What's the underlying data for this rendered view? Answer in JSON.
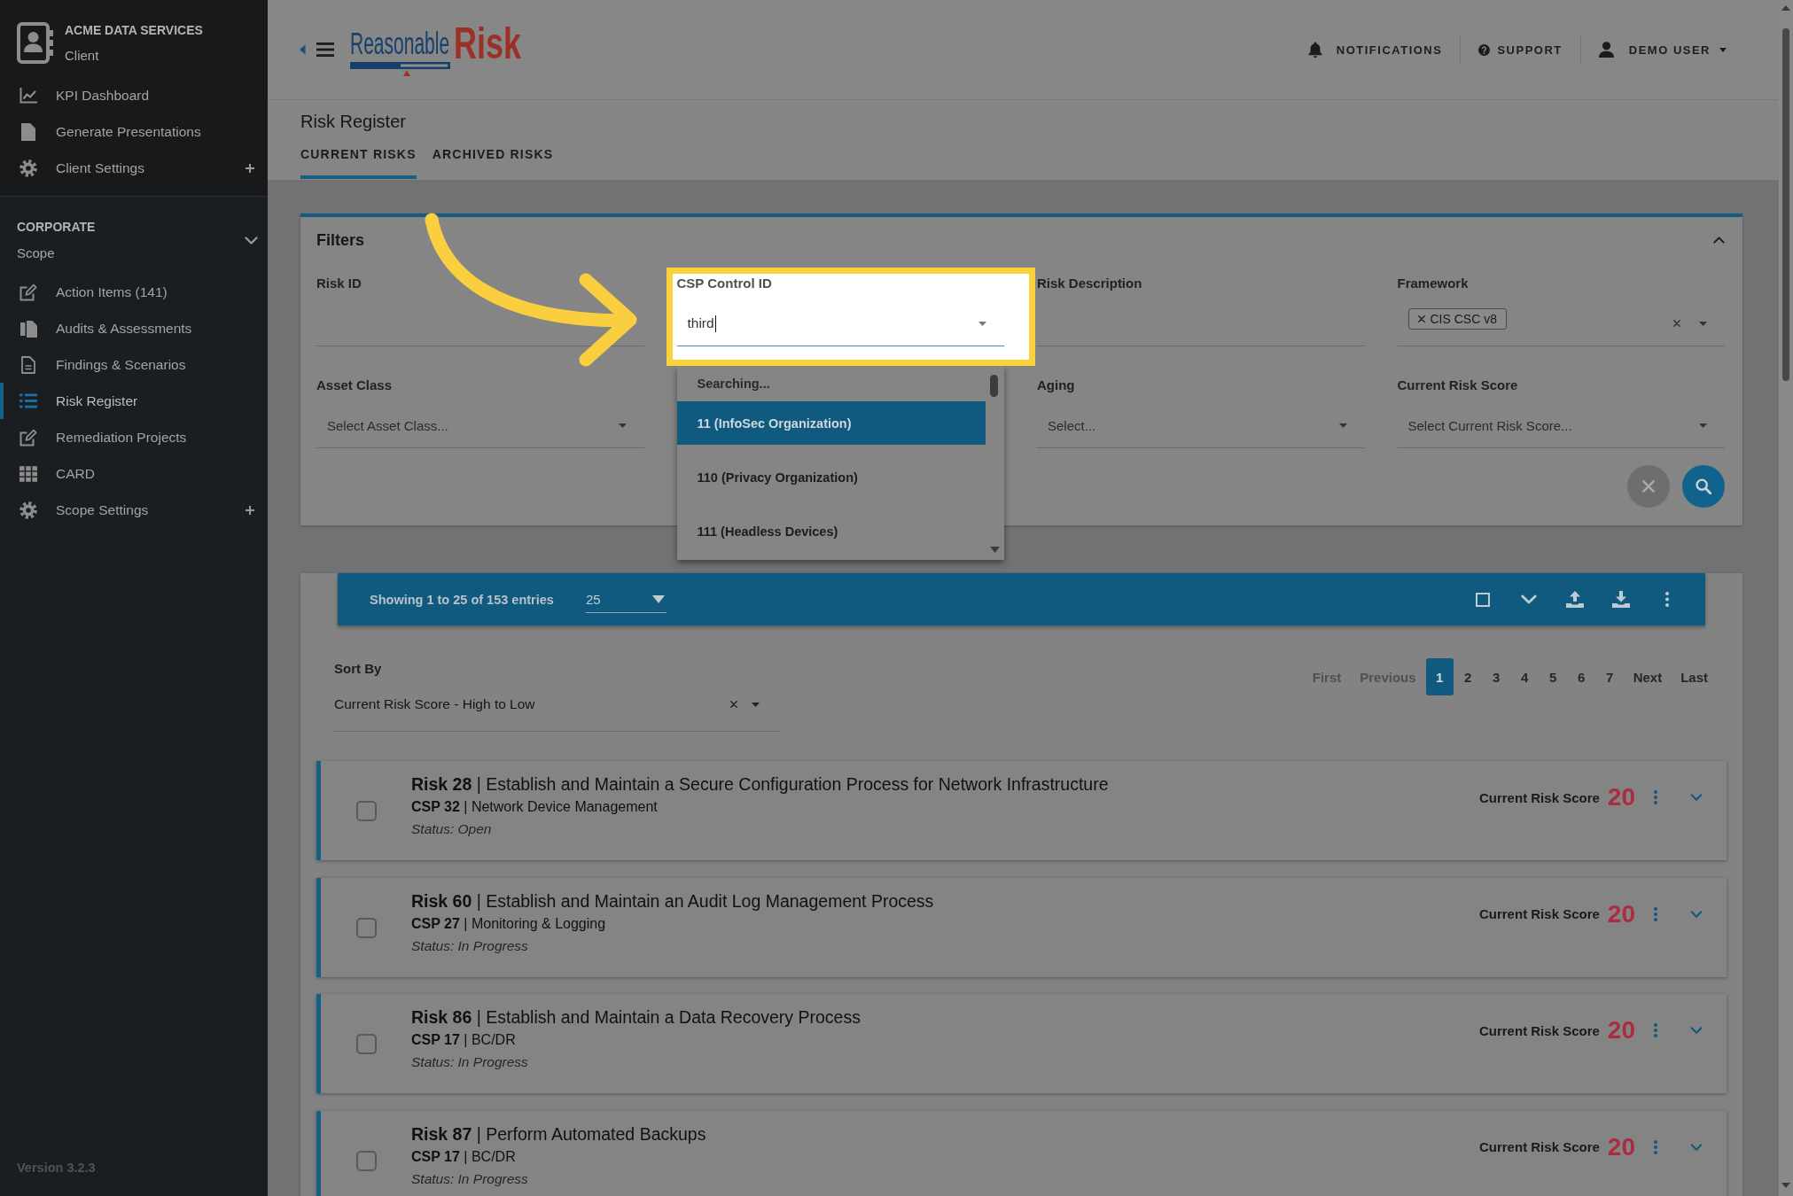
{
  "sidebar": {
    "client": {
      "name": "ACME DATA SERVICES",
      "type": "Client"
    },
    "client_items": [
      {
        "label": "KPI Dashboard",
        "kind": "dashboard",
        "expandable": false,
        "selected": false
      },
      {
        "label": "Generate Presentations",
        "kind": "presentations",
        "expandable": false,
        "selected": false
      },
      {
        "label": "Client Settings",
        "kind": "settings",
        "expandable": true,
        "selected": false
      }
    ],
    "scope": {
      "name": "CORPORATE",
      "type": "Scope",
      "expanded": true
    },
    "scope_items": [
      {
        "label": "Action Items (141)",
        "kind": "tasks",
        "expandable": false,
        "selected": false
      },
      {
        "label": "Audits & Assessments",
        "kind": "audits",
        "expandable": false,
        "selected": false
      },
      {
        "label": "Findings & Scenarios",
        "kind": "findings",
        "expandable": false,
        "selected": false
      },
      {
        "label": "Risk Register",
        "kind": "register",
        "expandable": false,
        "selected": true
      },
      {
        "label": "Remediation Projects",
        "kind": "projects",
        "expandable": false,
        "selected": false
      },
      {
        "label": "CARD",
        "kind": "grid",
        "expandable": false,
        "selected": false
      },
      {
        "label": "Scope Settings",
        "kind": "settings",
        "expandable": true,
        "selected": false
      }
    ],
    "version": "Version 3.2.3"
  },
  "header": {
    "logo": {
      "word": "Reasonable",
      "accent_word": "Risk"
    },
    "actions": [
      {
        "kind": "notifications",
        "label": "NOTIFICATIONS"
      },
      {
        "kind": "support",
        "label": "SUPPORT"
      },
      {
        "kind": "account",
        "label": "DEMO USER"
      }
    ]
  },
  "page": {
    "title": "Risk Register",
    "tabs": [
      {
        "label": "CURRENT RISKS",
        "selected": true
      },
      {
        "label": "ARCHIVED RISKS",
        "selected": false
      }
    ]
  },
  "filters": {
    "title": "Filters",
    "expanded": true,
    "fields": [
      {
        "kind": "text",
        "label": "Risk ID"
      },
      {
        "kind": "search",
        "label": "CSP Control ID",
        "value": "third",
        "focused": true,
        "highlighted": true,
        "dropdown": {
          "status": "Searching...",
          "options": [
            {
              "label": "11 (InfoSec Organization)",
              "selected": true
            },
            {
              "label": "110 (Privacy Organization)",
              "selected": false
            },
            {
              "label": "111 (Headless Devices)",
              "selected": false
            }
          ]
        }
      },
      {
        "kind": "text",
        "label": "Risk Description"
      },
      {
        "kind": "tags",
        "label": "Framework",
        "tags": [
          "CIS CSC v8"
        ]
      },
      {
        "kind": "select",
        "label": "Asset Class",
        "placeholder": "Select Asset Class..."
      },
      {
        "kind": "select",
        "label": "Aging",
        "placeholder": "Select..."
      },
      {
        "kind": "select",
        "label": "Current Risk Score",
        "placeholder": "Select Current Risk Score..."
      }
    ]
  },
  "results": {
    "summary": "Showing 1 to 25 of 153 entries",
    "page_size": "25",
    "sort": {
      "label": "Sort By",
      "value": "Current Risk Score - High to Low"
    },
    "pagination": [
      {
        "label": "First",
        "selected": false,
        "disabled": true
      },
      {
        "label": "Previous",
        "selected": false,
        "disabled": true
      },
      {
        "label": "1",
        "selected": true,
        "disabled": false
      },
      {
        "label": "2",
        "selected": false,
        "disabled": false
      },
      {
        "label": "3",
        "selected": false,
        "disabled": false
      },
      {
        "label": "4",
        "selected": false,
        "disabled": false
      },
      {
        "label": "5",
        "selected": false,
        "disabled": false
      },
      {
        "label": "6",
        "selected": false,
        "disabled": false
      },
      {
        "label": "7",
        "selected": false,
        "disabled": false
      },
      {
        "label": "Next",
        "selected": false,
        "disabled": false
      },
      {
        "label": "Last",
        "selected": false,
        "disabled": false
      }
    ],
    "risks": [
      {
        "title": "**Risk 28** | Establish and Maintain a Secure Configuration Process for Network Infrastructure",
        "control": "**CSP 32** | Network Device Management",
        "status": "Status: Open",
        "score_label": "Current Risk Score",
        "score": "20",
        "checked": false,
        "expanded": false
      },
      {
        "title": "**Risk 60** | Establish and Maintain an Audit Log Management Process",
        "control": "**CSP 27** | Monitoring & Logging",
        "status": "Status: In Progress",
        "score_label": "Current Risk Score",
        "score": "20",
        "checked": false,
        "expanded": false
      },
      {
        "title": "**Risk 86** | Establish and Maintain a Data Recovery Process",
        "control": "**CSP 17** | BC/DR",
        "status": "Status: In Progress",
        "score_label": "Current Risk Score",
        "score": "20",
        "checked": false,
        "expanded": false
      },
      {
        "title": "**Risk 87** | Perform Automated Backups",
        "control": "**CSP 17** | BC/DR",
        "status": "Status: In Progress",
        "score_label": "Current Risk Score",
        "score": "20",
        "checked": false,
        "expanded": false
      }
    ]
  }
}
